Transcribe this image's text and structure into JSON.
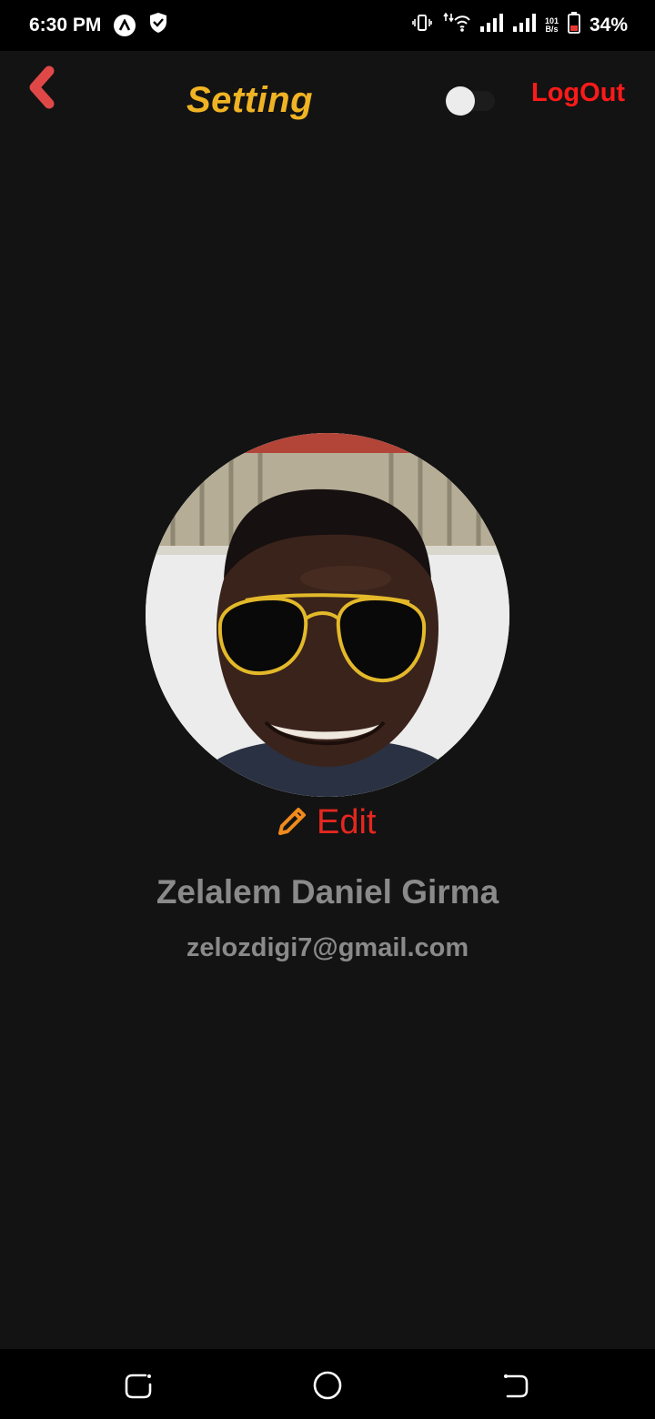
{
  "status_bar": {
    "time": "6:30 PM",
    "net_speed_value": "101",
    "net_speed_unit": "B/s",
    "battery": "34%",
    "icons": [
      "app-notification-icon",
      "shield-icon",
      "vibrate-icon",
      "wifi-icon",
      "signal-icon",
      "signal-icon",
      "battery-icon"
    ]
  },
  "header": {
    "title": "Setting",
    "logout_label": "LogOut",
    "back_icon": "chevron-left-icon",
    "theme_toggle_on": false
  },
  "profile": {
    "edit_label": "Edit",
    "edit_icon": "pencil-icon",
    "name": "Zelalem Daniel Girma",
    "email": "zelozdigi7@gmail.com"
  },
  "nav_bar": {
    "icons": [
      "recent-apps-icon",
      "home-icon",
      "back-icon"
    ]
  },
  "colors": {
    "background": "#131313",
    "title": "#f0b323",
    "logout": "#ff1a1a",
    "back_chevron": "#e04848",
    "edit_text": "#e5271f",
    "edit_icon": "#f08a1c",
    "profile_text": "#8a8a8a"
  }
}
